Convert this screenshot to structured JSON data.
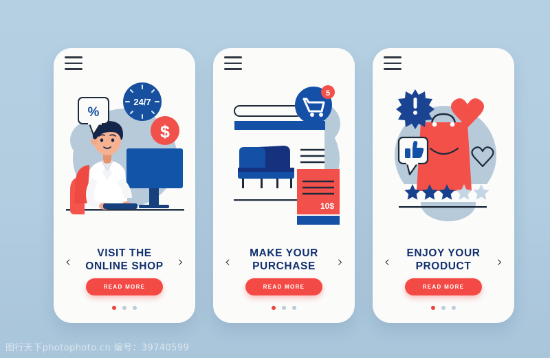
{
  "meta": {
    "background_color": "#b3cee2",
    "card_background": "#fbfbfa",
    "accent_red": "#f44a45",
    "accent_dark_blue": "#12306e",
    "accent_blue": "#1254a8",
    "blob_color": "#b6cada"
  },
  "watermark": "图行天下photophoto.cn  编号：39740599",
  "cards": [
    {
      "id": "visit-the-online-shop",
      "menu_icon": "hamburger-menu-icon",
      "title_line_1": "VISIT THE",
      "title_line_2": "ONLINE SHOP",
      "cta_label": "READ MORE",
      "prev_label": "‹",
      "next_label": "›",
      "illustration": {
        "name": "man-at-desktop-computer",
        "clock_label": "24/7",
        "bubble_label": "%",
        "coin_label": "$",
        "icons": [
          "clock-icon",
          "percent-speech-bubble-icon",
          "dollar-coin-icon",
          "person-icon",
          "monitor-icon",
          "keyboard-icon",
          "chair-icon"
        ]
      },
      "dots": {
        "count": 3,
        "active_index": 0
      }
    },
    {
      "id": "make-your-purchase",
      "menu_icon": "hamburger-menu-icon",
      "title_line_1": "MAKE YOUR",
      "title_line_2": "PURCHASE",
      "cta_label": "READ MORE",
      "prev_label": "‹",
      "next_label": "›",
      "illustration": {
        "name": "online-store-page-with-sofa",
        "cart_badge_count": "5",
        "price_label": "10$",
        "icons": [
          "shopping-cart-icon",
          "cart-count-badge",
          "search-bar-icon",
          "search-magnifier-badge",
          "sofa-icon",
          "price-card-icon",
          "text-lines-icon"
        ]
      },
      "dots": {
        "count": 3,
        "active_index": 0
      }
    },
    {
      "id": "enjoy-your-product",
      "menu_icon": "hamburger-menu-icon",
      "title_line_1": "ENJOY YOUR",
      "title_line_2": "PRODUCT",
      "cta_label": "READ MORE",
      "prev_label": "‹",
      "next_label": "›",
      "illustration": {
        "name": "shopping-bag-with-reviews",
        "burst_label": "!",
        "rating_filled": 3,
        "rating_total": 5,
        "icons": [
          "shopping-bag-icon",
          "heart-filled-icon",
          "heart-outline-icon",
          "thumbs-up-speech-bubble-icon",
          "exclamation-burst-icon",
          "star-rating-icon"
        ]
      },
      "dots": {
        "count": 3,
        "active_index": 0
      }
    }
  ]
}
